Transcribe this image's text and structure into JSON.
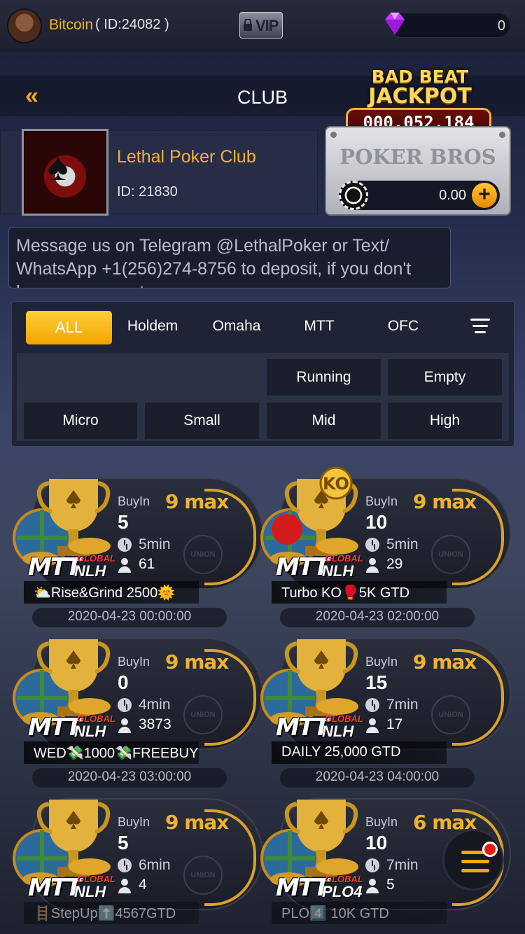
{
  "user": {
    "name": "Bitcoin",
    "id_text": "( ID:24082 )",
    "vip_label": "VIP",
    "gems": "0"
  },
  "header": {
    "title": "CLUB",
    "back_symbol": "«"
  },
  "jackpot": {
    "line1": "BAD BEAT",
    "line2": "JACKPOT",
    "amount": "000,052,184"
  },
  "club": {
    "name": "Lethal Poker Club",
    "id_text": "ID: 21830"
  },
  "bros": {
    "title": "POKER BROS",
    "balance": "0.00",
    "plus": "+"
  },
  "message": "Message us on Telegram @LethalPoker or Text/ WhatsApp +1(256)274-8756 to deposit, if you don't have an account",
  "tabs": [
    "ALL",
    "Holdem",
    "Omaha",
    "MTT",
    "OFC"
  ],
  "status_filters": [
    "Running",
    "Empty"
  ],
  "stake_filters": [
    "Micro",
    "Small",
    "Mid",
    "High"
  ],
  "cards": [
    {
      "buyin_label": "BuyIn",
      "max": "9 max",
      "buyin": "5",
      "mins": "5min",
      "players": "61",
      "name": "⛅Rise&Grind 2500🌞",
      "date": "2020-04-23 00:00:00",
      "game": "NLH",
      "badge": "",
      "union": "UNION"
    },
    {
      "buyin_label": "BuyIn",
      "max": "9 max",
      "buyin": "10",
      "mins": "5min",
      "players": "29",
      "name": "Turbo KO🥊5K GTD",
      "date": "2020-04-23 02:00:00",
      "game": "NLH",
      "badge": "KO",
      "union": "UNION"
    },
    {
      "buyin_label": "BuyIn",
      "max": "9 max",
      "buyin": "0",
      "mins": "4min",
      "players": "3873",
      "name": "WED💸1000💸FREEBUY",
      "date": "2020-04-23 03:00:00",
      "game": "NLH",
      "badge": "",
      "union": "UNION"
    },
    {
      "buyin_label": "BuyIn",
      "max": "9 max",
      "buyin": "15",
      "mins": "7min",
      "players": "17",
      "name": "DAILY 25,000 GTD",
      "date": "2020-04-23 04:00:00",
      "game": "NLH",
      "badge": "",
      "union": "UNION"
    },
    {
      "buyin_label": "BuyIn",
      "max": "9 max",
      "buyin": "5",
      "mins": "6min",
      "players": "4",
      "name": "🪜StepUp⬆️4567GTD",
      "date": "",
      "game": "NLH",
      "badge": "",
      "union": "UNION"
    },
    {
      "buyin_label": "BuyIn",
      "max": "6 max",
      "buyin": "10",
      "mins": "7min",
      "players": "5",
      "name": "PLO4️⃣ 10K GTD",
      "date": "",
      "game": "PLO4",
      "badge": "",
      "union": ""
    }
  ],
  "mtt_label": "MTT",
  "global_label": "GLOBAL",
  "colors": {
    "accent": "#f2b233",
    "tab_active": "#f2a400",
    "jackpot_bg": "#5a0c08",
    "notify": "#e8181a"
  },
  "icons": [
    "avatar",
    "lock-icon",
    "gem-icon",
    "back-icon",
    "chip-icon",
    "plus-icon",
    "filter-menu-icon",
    "clock-icon",
    "person-icon",
    "trophy-icon",
    "menu-icon"
  ]
}
